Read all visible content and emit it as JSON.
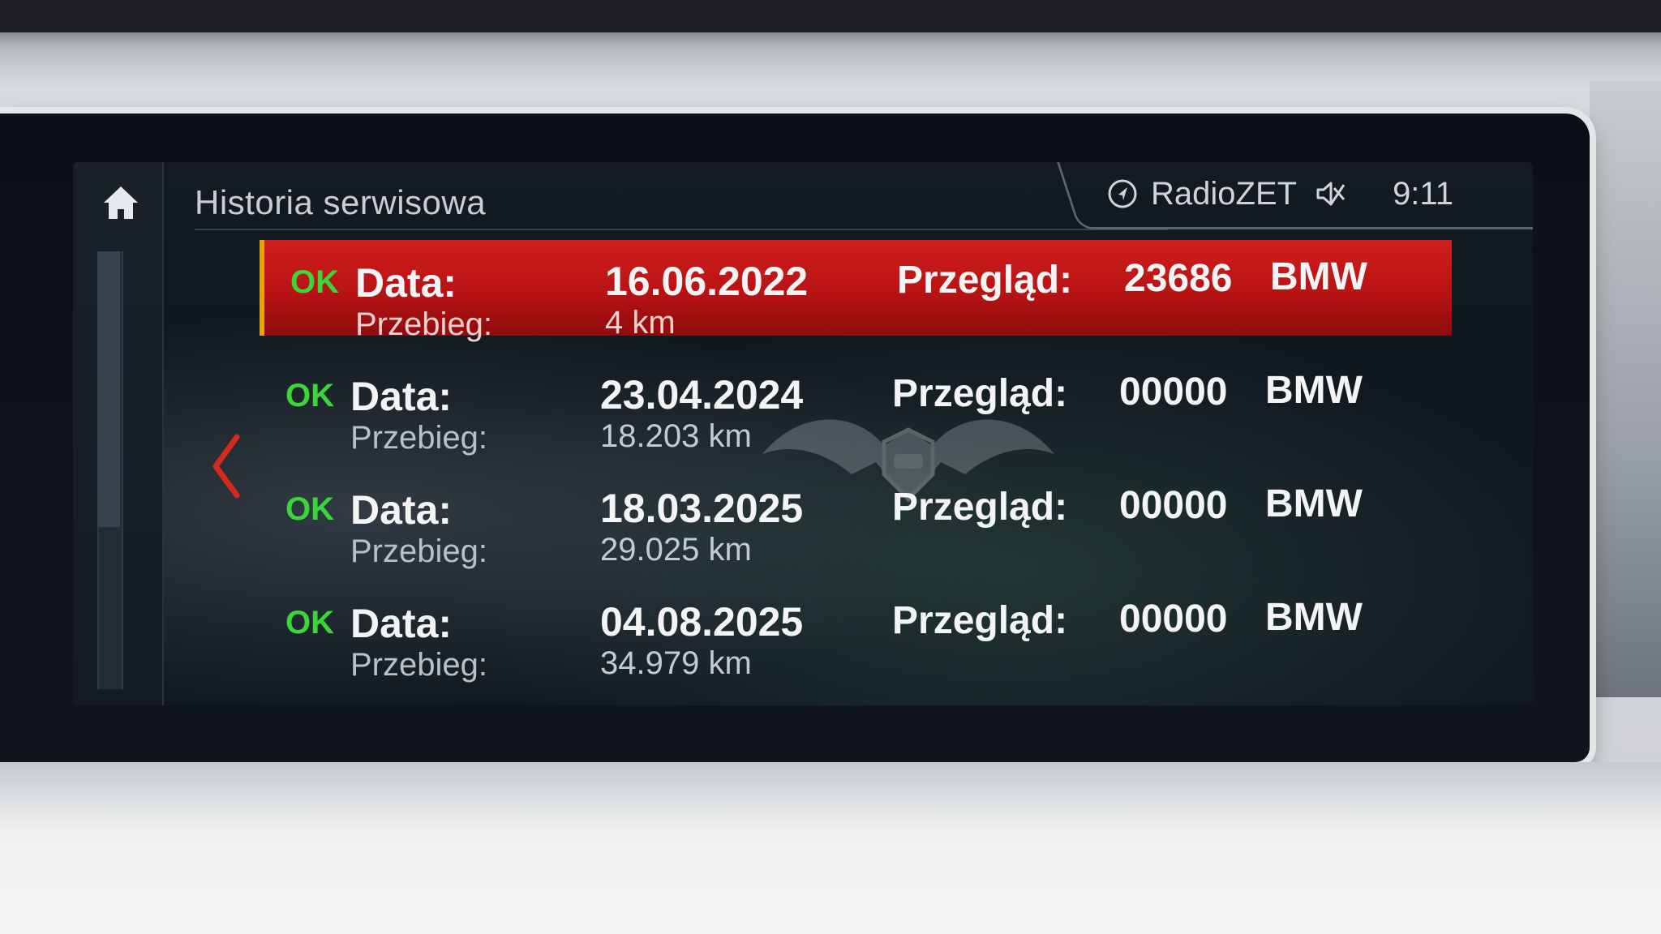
{
  "header": {
    "title": "Historia serwisowa"
  },
  "status": {
    "source": "RadioZET",
    "time": "9:11"
  },
  "labels": {
    "ok": "OK",
    "data": "Data:",
    "przebieg": "Przebieg:",
    "przeglad": "Przegląd:"
  },
  "records": [
    {
      "date": "16.06.2022",
      "mileage": "4 km",
      "inspection": "23686",
      "brand": "BMW",
      "selected": true
    },
    {
      "date": "23.04.2024",
      "mileage": "18.203 km",
      "inspection": "00000",
      "brand": "BMW",
      "selected": false
    },
    {
      "date": "18.03.2025",
      "mileage": "29.025 km",
      "inspection": "00000",
      "brand": "BMW",
      "selected": false
    },
    {
      "date": "04.08.2025",
      "mileage": "34.979 km",
      "inspection": "00000",
      "brand": "BMW",
      "selected": false
    }
  ],
  "icons": {
    "home": "home-icon",
    "navigation": "navigation-arrow-icon",
    "mute": "speaker-muted-icon",
    "back": "chevron-left-icon"
  },
  "colors": {
    "selection": "#c41818",
    "ok": "#3ad63a",
    "selection_edge": "#e8a300"
  }
}
